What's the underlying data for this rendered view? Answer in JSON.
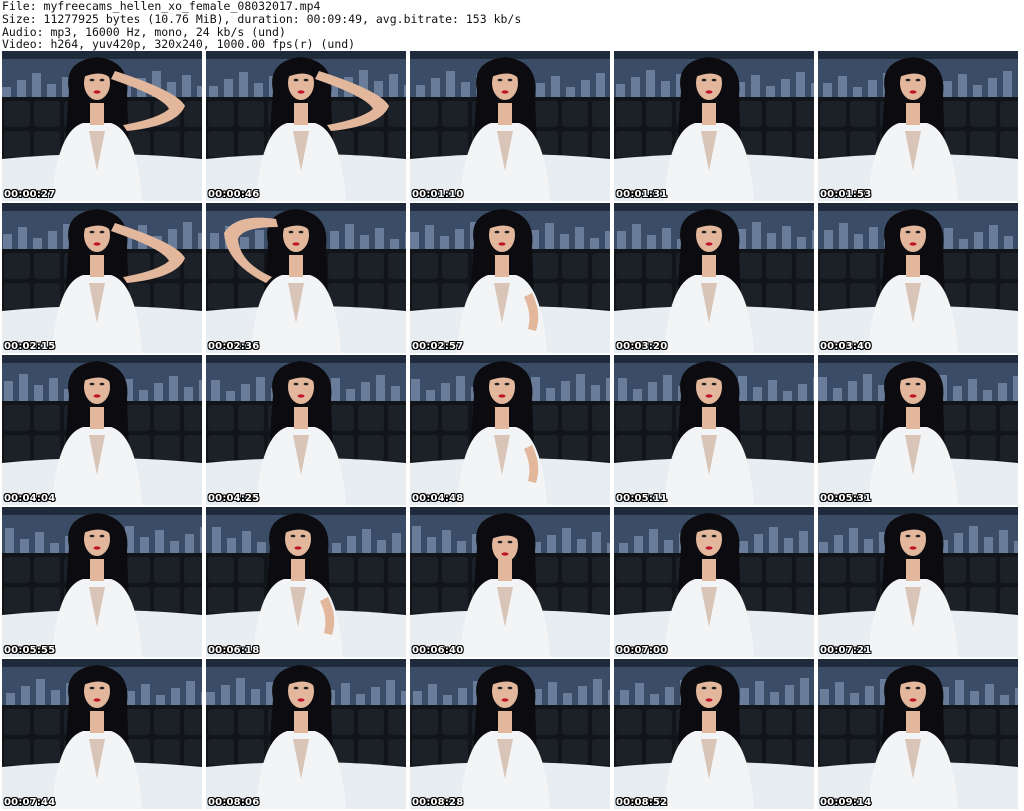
{
  "header": {
    "file_line": "File: myfreecams_hellen_xo_female_08032017.mp4",
    "size_line": "Size: 11277925 bytes (10.76 MiB), duration: 00:09:49, avg.bitrate: 153 kb/s",
    "audio_line": "Audio: mp3, 16000 Hz, mono, 24 kb/s (und)",
    "video_line": "Video: h264, yuv420p, 320x240, 1000.00 fps(r) (und)"
  },
  "thumbnails": [
    {
      "timestamp": "00:00:27",
      "pose": "arm-up-right"
    },
    {
      "timestamp": "00:00:46",
      "pose": "arm-up-right"
    },
    {
      "timestamp": "00:01:10",
      "pose": "neutral"
    },
    {
      "timestamp": "00:01:31",
      "pose": "neutral"
    },
    {
      "timestamp": "00:01:53",
      "pose": "neutral"
    },
    {
      "timestamp": "00:02:15",
      "pose": "arm-up-right"
    },
    {
      "timestamp": "00:02:36",
      "pose": "arm-up-left"
    },
    {
      "timestamp": "00:02:57",
      "pose": "hand-hair"
    },
    {
      "timestamp": "00:03:20",
      "pose": "neutral"
    },
    {
      "timestamp": "00:03:40",
      "pose": "neutral"
    },
    {
      "timestamp": "00:04:04",
      "pose": "neutral"
    },
    {
      "timestamp": "00:04:25",
      "pose": "neutral"
    },
    {
      "timestamp": "00:04:48",
      "pose": "hand-hair"
    },
    {
      "timestamp": "00:05:11",
      "pose": "neutral"
    },
    {
      "timestamp": "00:05:31",
      "pose": "neutral"
    },
    {
      "timestamp": "00:05:55",
      "pose": "neutral"
    },
    {
      "timestamp": "00:06:18",
      "pose": "hand-hair"
    },
    {
      "timestamp": "00:06:40",
      "pose": "head-down"
    },
    {
      "timestamp": "00:07:00",
      "pose": "neutral"
    },
    {
      "timestamp": "00:07:21",
      "pose": "neutral"
    },
    {
      "timestamp": "00:07:44",
      "pose": "neutral"
    },
    {
      "timestamp": "00:08:06",
      "pose": "neutral"
    },
    {
      "timestamp": "00:08:28",
      "pose": "neutral"
    },
    {
      "timestamp": "00:08:52",
      "pose": "neutral"
    },
    {
      "timestamp": "00:09:14",
      "pose": "neutral"
    }
  ],
  "colors": {
    "background": "#ffffff",
    "header_text": "#111111",
    "wall": "#1f2a3a",
    "city_light": "#8fa6c4",
    "headboard": "#111418",
    "bedsheet": "#e8edf2",
    "hair": "#0b0b10",
    "skin": "#e2b79c",
    "top": "#f2f4f6",
    "lips": "#c0122a"
  }
}
